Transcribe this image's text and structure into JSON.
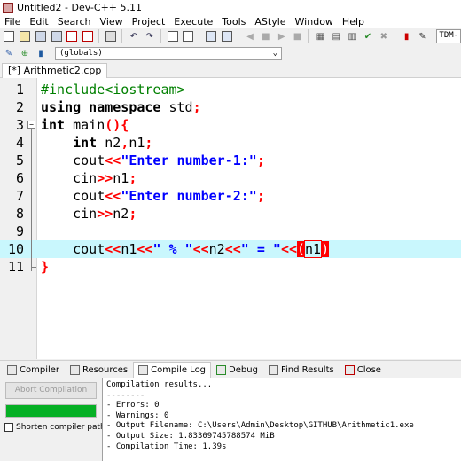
{
  "window": {
    "title": "Untitled2 - Dev-C++ 5.11"
  },
  "menu": [
    "File",
    "Edit",
    "Search",
    "View",
    "Project",
    "Execute",
    "Tools",
    "AStyle",
    "Window",
    "Help"
  ],
  "toolbar": {
    "compiler": "TDM-"
  },
  "scope": {
    "value": "(globals)"
  },
  "tab": {
    "label": "[*] Arithmetic2.cpp"
  },
  "editor": {
    "line_numbers": [
      "1",
      "2",
      "3",
      "4",
      "5",
      "6",
      "7",
      "8",
      "9",
      "10",
      "11"
    ],
    "lines": [
      {
        "segments": [
          {
            "t": "#include<iostream>",
            "c": "pp"
          }
        ]
      },
      {
        "segments": [
          {
            "t": "using namespace",
            "c": "kw"
          },
          {
            "t": " std",
            "c": ""
          },
          {
            "t": ";",
            "c": "op"
          }
        ]
      },
      {
        "segments": [
          {
            "t": "int",
            "c": "kw"
          },
          {
            "t": " main",
            "c": ""
          },
          {
            "t": "(){",
            "c": "op"
          }
        ]
      },
      {
        "segments": [
          {
            "t": "    ",
            "c": ""
          },
          {
            "t": "int",
            "c": "kw"
          },
          {
            "t": " n2",
            "c": ""
          },
          {
            "t": ",",
            "c": "op"
          },
          {
            "t": "n1",
            "c": ""
          },
          {
            "t": ";",
            "c": "op"
          }
        ]
      },
      {
        "segments": [
          {
            "t": "    cout",
            "c": ""
          },
          {
            "t": "<<",
            "c": "op"
          },
          {
            "t": "\"Enter number-1:\"",
            "c": "str"
          },
          {
            "t": ";",
            "c": "op"
          }
        ]
      },
      {
        "segments": [
          {
            "t": "    cin",
            "c": ""
          },
          {
            "t": ">>",
            "c": "op"
          },
          {
            "t": "n1",
            "c": ""
          },
          {
            "t": ";",
            "c": "op"
          }
        ]
      },
      {
        "segments": [
          {
            "t": "    cout",
            "c": ""
          },
          {
            "t": "<<",
            "c": "op"
          },
          {
            "t": "\"Enter number-2:\"",
            "c": "str"
          },
          {
            "t": ";",
            "c": "op"
          }
        ]
      },
      {
        "segments": [
          {
            "t": "    cin",
            "c": ""
          },
          {
            "t": ">>",
            "c": "op"
          },
          {
            "t": "n2",
            "c": ""
          },
          {
            "t": ";",
            "c": "op"
          }
        ]
      },
      {
        "segments": []
      },
      {
        "segments": [
          {
            "t": "    cout",
            "c": ""
          },
          {
            "t": "<<",
            "c": "op"
          },
          {
            "t": "n1",
            "c": ""
          },
          {
            "t": "<<",
            "c": "op"
          },
          {
            "t": "\" % \"",
            "c": "str"
          },
          {
            "t": "<<",
            "c": "op"
          },
          {
            "t": "n2",
            "c": ""
          },
          {
            "t": "<<",
            "c": "op"
          },
          {
            "t": "\" = \"",
            "c": "str"
          },
          {
            "t": "<<",
            "c": "op"
          },
          {
            "t": "(",
            "c": "match"
          },
          {
            "t": "n1",
            "c": "cursor"
          },
          {
            "t": ")",
            "c": "match"
          }
        ]
      },
      {
        "segments": [
          {
            "t": "}",
            "c": "op"
          }
        ]
      }
    ]
  },
  "bottom_tabs": [
    "Compiler",
    "Resources",
    "Compile Log",
    "Debug",
    "Find Results",
    "Close"
  ],
  "compile_panel": {
    "abort_label": "Abort Compilation",
    "progress": 1.0,
    "shorten_label": "Shorten compiler paths",
    "log": [
      "Compilation results...",
      "--------",
      "- Errors: 0",
      "- Warnings: 0",
      "- Output Filename: C:\\Users\\Admin\\Desktop\\GITHUB\\Arithmetic1.exe",
      "- Output Size: 1.83309745788574 MiB",
      "- Compilation Time: 1.39s"
    ]
  }
}
